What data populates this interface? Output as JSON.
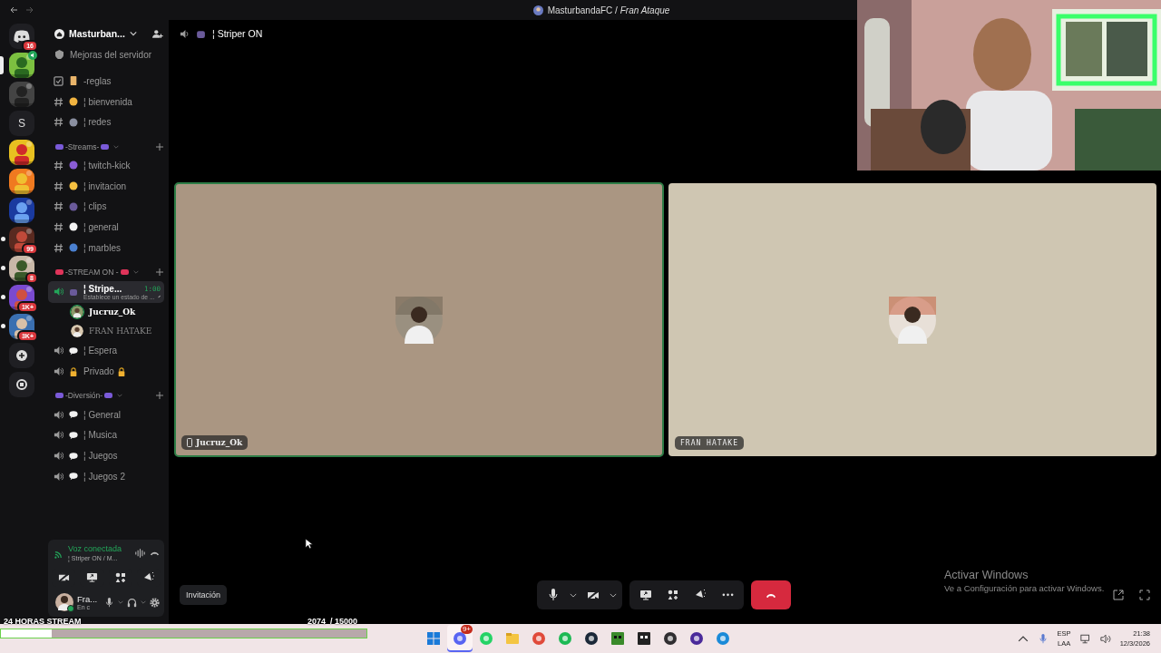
{
  "titlebar": {
    "title": "MasturbandaFC / *Fran Ataque*"
  },
  "server_rail": [
    {
      "kind": "home",
      "badge": "16",
      "unread": false,
      "selected": false
    },
    {
      "kind": "server",
      "voice": true,
      "unread": false,
      "selected": true
    },
    {
      "kind": "server",
      "unread": false,
      "selected": false
    },
    {
      "kind": "letter",
      "label": "S",
      "unread": false,
      "selected": false
    },
    {
      "kind": "server",
      "unread": false,
      "selected": false
    },
    {
      "kind": "server",
      "unread": false,
      "selected": false
    },
    {
      "kind": "server",
      "unread": false,
      "selected": false
    },
    {
      "kind": "server",
      "badge": "99",
      "unread": true,
      "selected": false
    },
    {
      "kind": "server",
      "badge": "8",
      "unread": true,
      "selected": false
    },
    {
      "kind": "server",
      "badge": "1K+",
      "unread": true,
      "selected": false
    },
    {
      "kind": "server",
      "badge": "3K+",
      "unread": true,
      "selected": false
    },
    {
      "kind": "add",
      "unread": false,
      "selected": false
    },
    {
      "kind": "discover",
      "unread": false,
      "selected": false
    }
  ],
  "server": {
    "name": "Masturban...",
    "boost": "Mejoras del servidor"
  },
  "sections": [
    {
      "channels": [
        {
          "kind": "rules",
          "label": "-reglas",
          "selected": false
        },
        {
          "kind": "text",
          "label": "¦ bienvenida",
          "selected": false
        },
        {
          "kind": "text",
          "label": "¦ redes",
          "selected": false
        }
      ]
    },
    {
      "title": "-Streams-",
      "channels": [
        {
          "kind": "text",
          "label": "¦ twitch-kick",
          "selected": false
        },
        {
          "kind": "text",
          "label": "¦ invitacion",
          "selected": false
        },
        {
          "kind": "text",
          "label": "¦ clips",
          "selected": false
        },
        {
          "kind": "text",
          "label": "¦ general",
          "selected": false
        },
        {
          "kind": "text",
          "label": "¦ marbles",
          "selected": false
        }
      ]
    },
    {
      "title": "-STREAM ON -",
      "channels": [
        {
          "kind": "voice",
          "label": "¦ Stripe...",
          "time": "1:00",
          "status": "Establece un estado de ...",
          "selected": true,
          "members": [
            {
              "name": "Jucruz_Ok",
              "speaking": true
            },
            {
              "name": "FRAN HATAKE",
              "speaking": false
            }
          ]
        },
        {
          "kind": "voice",
          "label": "¦ Espera",
          "locked": false,
          "selected": false
        },
        {
          "kind": "voice",
          "label": "Privado",
          "locked": true,
          "selected": false
        }
      ]
    },
    {
      "title": "-Diversión-",
      "channels": [
        {
          "kind": "voice",
          "label": "¦ General",
          "locked": false,
          "selected": false
        },
        {
          "kind": "voice",
          "label": "¦ Musica",
          "locked": false,
          "selected": false
        },
        {
          "kind": "voice",
          "label": "¦ Juegos",
          "locked": false,
          "selected": false
        },
        {
          "kind": "voice",
          "label": "¦ Juegos 2",
          "locked": false,
          "selected": false
        }
      ]
    }
  ],
  "voice_panel": {
    "status": "Voz conectada",
    "channel": "¦ Striper ON / M..."
  },
  "user_panel": {
    "name": "Fra...",
    "status": "En c"
  },
  "main": {
    "channel": "¦ Striper ON"
  },
  "tiles": [
    {
      "name": "Jucruz_Ok",
      "mobile": true,
      "speaking": true,
      "color": "#aa9682"
    },
    {
      "name": "FRAN HATAKE",
      "mobile": false,
      "speaking": false,
      "color": "#cfc6b2"
    }
  ],
  "invite_button": "Invitación",
  "activation": {
    "title": "Activar Windows",
    "text": "Ve a Configuración para activar Windows."
  },
  "stream_overlay": {
    "title": "24 HORAS STREAM",
    "count": "2074  / 15000",
    "level": 0.14
  },
  "taskbar": {
    "apps": [
      {
        "kind": "start",
        "active": false
      },
      {
        "kind": "discord",
        "badge": "9+",
        "active": true
      },
      {
        "kind": "whatsapp",
        "active": false
      },
      {
        "kind": "files",
        "active": false
      },
      {
        "kind": "chrome",
        "active": false
      },
      {
        "kind": "spotify",
        "active": false
      },
      {
        "kind": "steam",
        "active": false
      },
      {
        "kind": "minecraft",
        "active": false
      },
      {
        "kind": "epic",
        "active": false
      },
      {
        "kind": "obs",
        "active": false
      },
      {
        "kind": "circle",
        "active": false
      },
      {
        "kind": "edge",
        "active": false
      }
    ],
    "lang": "ESP",
    "layout": "LAA",
    "time": "21:38",
    "date": "12/3/2026"
  }
}
